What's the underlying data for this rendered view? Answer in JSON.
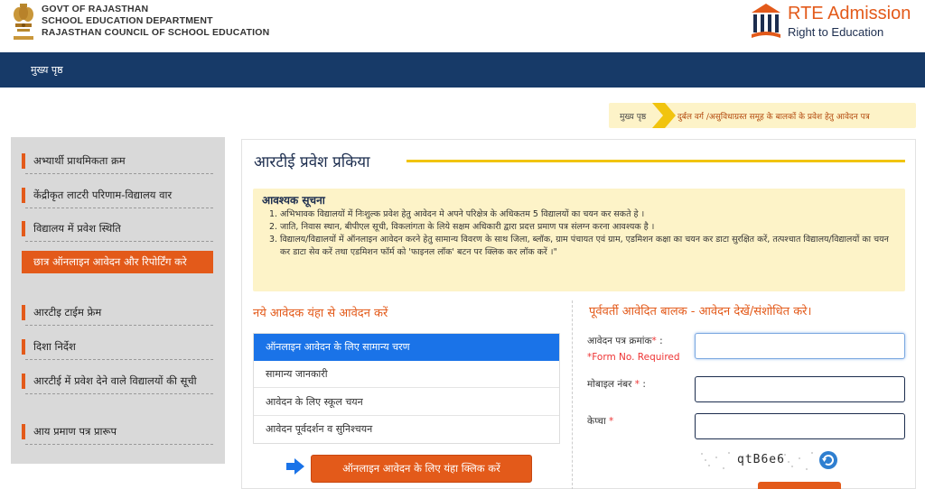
{
  "header": {
    "govt_line1": "GOVT OF RAJASTHAN",
    "govt_line2": "SCHOOL EDUCATION DEPARTMENT",
    "govt_line3": "RAJASTHAN COUNCIL OF SCHOOL EDUCATION",
    "brand_title": "RTE Admission",
    "brand_subtitle": "Right to Education"
  },
  "nav": {
    "home": "मुख्य पृष्ठ"
  },
  "breadcrumb": {
    "home": "मुख्य पृष्ठ",
    "current": "दुर्बल वर्ग /असुविधाग्रस्त समूह के बालकों के प्रवेश हेतु आवेदन पत्र"
  },
  "sidebar": {
    "items": [
      {
        "label": "अभ्यार्थी प्राथमिकता क्रम"
      },
      {
        "label": "केंद्रीकृत लाटरी परिणाम-विद्यालय वार"
      },
      {
        "label": "विद्यालय में प्रवेश स्थिति"
      },
      {
        "label": "छात्र ऑनलाइन आवेदन और रिपोर्टिंग करे"
      },
      {
        "label": "आरटीइ टाईम फ्रेम"
      },
      {
        "label": "दिशा निर्देश"
      },
      {
        "label": "आरटीई में प्रवेश देने वाले विद्यालयों की सूची"
      },
      {
        "label": "आय प्रमाण पत्र प्रारूप"
      }
    ],
    "active_index": 3
  },
  "main": {
    "title": "आरटीई प्रवेश प्रकिया",
    "notice": {
      "title": "आवश्यक सूचना",
      "items": [
        "अभिभावक विद्यालयों में निःशुल्क प्रवेश हेतु आवेदन मे अपने परिक्षेत्र के अधिकतम 5 विद्यालयों का चयन कर सकते हे ।",
        "जाति, निवास स्थान, बीपीएल सूची, विकलांगता के लिये सक्षम अधिकारी द्वारा प्रदत्त प्रमाण पत्र संलग्न करना आवश्यक है ।",
        "विद्यालय/विद्यालयों में ऑनलाइन आवेदन करने हेतु सामान्य विवरण के साथ जिला, ब्लॉक, ग्राम पंचायत एवं ग्राम, एडमिशन कक्षा का चयन कर डाटा सुरक्षित करें, तत्पश्चात विद्यालय/विद्यालयों का चयन कर डाटा सेव करें तथा एडमिशन फॉर्म को 'फाइनल लॉक' बटन पर क्लिक कर लॉक करें ।\""
      ]
    },
    "new_applicant": {
      "heading": "नये आवेदक यंहा से आवेदन करें",
      "steps": [
        "ऑनलाइन आवेदन के लिए सामान्य चरण",
        "सामान्य जानकारी",
        "आवेदन के लिए स्कूल चयन",
        "आवेदन पूर्वदर्शन व सुनिश्चयन"
      ],
      "apply_button": "ऑनलाइन आवेदन के लिए यंहा क्लिक करें"
    },
    "previous_applicant": {
      "heading": "पूर्ववर्ती आवेदित बालक - आवेदन देखें/संशोधित करे।",
      "form_no_label": "आवेदन पत्र क्रमांक",
      "form_no_required": "*Form No. Required",
      "mobile_label": "मोबाइल नंबर",
      "captcha_label": "केप्चा",
      "captcha_text": "qtB6e6",
      "star": "*",
      "colon": ":"
    }
  },
  "colors": {
    "accent": "#e35a1a",
    "navy": "#173a68",
    "notice_bg": "#fdf3c8",
    "active_step": "#1a73e8"
  },
  "icons": [
    "emblem-icon",
    "rte-logo-icon",
    "arrow-right-icon",
    "refresh-icon"
  ]
}
